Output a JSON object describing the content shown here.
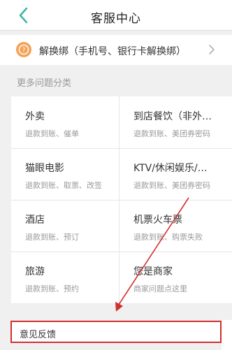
{
  "header": {
    "title": "客服中心",
    "back_icon": "chevron-left-icon"
  },
  "unbind": {
    "label": "解换绑（手机号、银行卡解换绑）",
    "icon": "question-icon",
    "icon_color": "#f5a258"
  },
  "section": {
    "label": "更多问题分类"
  },
  "categories": [
    {
      "title": "外卖",
      "sub": "退款到账、催单"
    },
    {
      "title": "到店餐饮（非外…",
      "sub": "退款到账、美团券密码"
    },
    {
      "title": "猫眼电影",
      "sub": "退款到账、取票、改签"
    },
    {
      "title": "KTV/休闲娱乐/…",
      "sub": "退款到账、美团券密码"
    },
    {
      "title": "酒店",
      "sub": "退款到账、预订"
    },
    {
      "title": "机票火车票",
      "sub": "退款到账、购票失败"
    },
    {
      "title": "旅游",
      "sub": "退款到账、预约"
    },
    {
      "title": "您是商家",
      "sub": "商家问题点这里"
    }
  ],
  "feedback": {
    "label": "意见反馈",
    "highlight_color": "#d22f2f"
  },
  "colors": {
    "accent": "#3cb4a8",
    "annotation": "#d22f2f"
  }
}
